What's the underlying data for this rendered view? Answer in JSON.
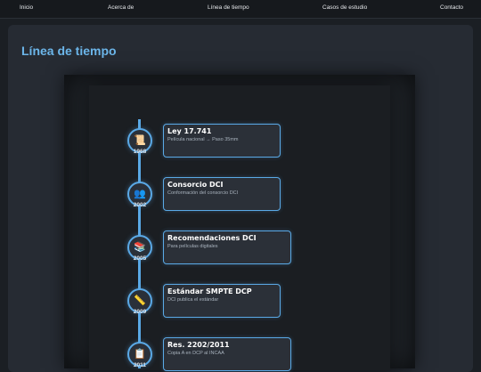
{
  "nav": {
    "items": [
      "Inicio",
      "Acerca de",
      "Línea de tiempo",
      "Casos de estudio",
      "Contacto"
    ]
  },
  "page": {
    "title": "Línea de tiempo"
  },
  "colors": {
    "accent": "#5aa9e6",
    "title": "#6cb6ea",
    "background": "#1b1f24",
    "card": "#262b33"
  },
  "timeline": {
    "events": [
      {
        "year": "1968",
        "title": "Ley 17.741",
        "description": "Película nacional → Paso 35mm",
        "icon": "scroll-icon",
        "glyph": "📜"
      },
      {
        "year": "2002",
        "title": "Consorcio DCI",
        "description": "Conformación del consorcio DCI",
        "icon": "people-icon",
        "glyph": "👥"
      },
      {
        "year": "2005",
        "title": "Recomendaciones DCI",
        "description": "Para películas digitales",
        "icon": "books-icon",
        "glyph": "📚"
      },
      {
        "year": "2009",
        "title": "Estándar SMPTE DCP",
        "description": "DCI publica el estándar",
        "icon": "ruler-icon",
        "glyph": "📏"
      },
      {
        "year": "2011",
        "title": "Res. 2202/2011",
        "description": "Copia A en DCP al INCAA",
        "icon": "clipboard-icon",
        "glyph": "📋"
      }
    ]
  }
}
